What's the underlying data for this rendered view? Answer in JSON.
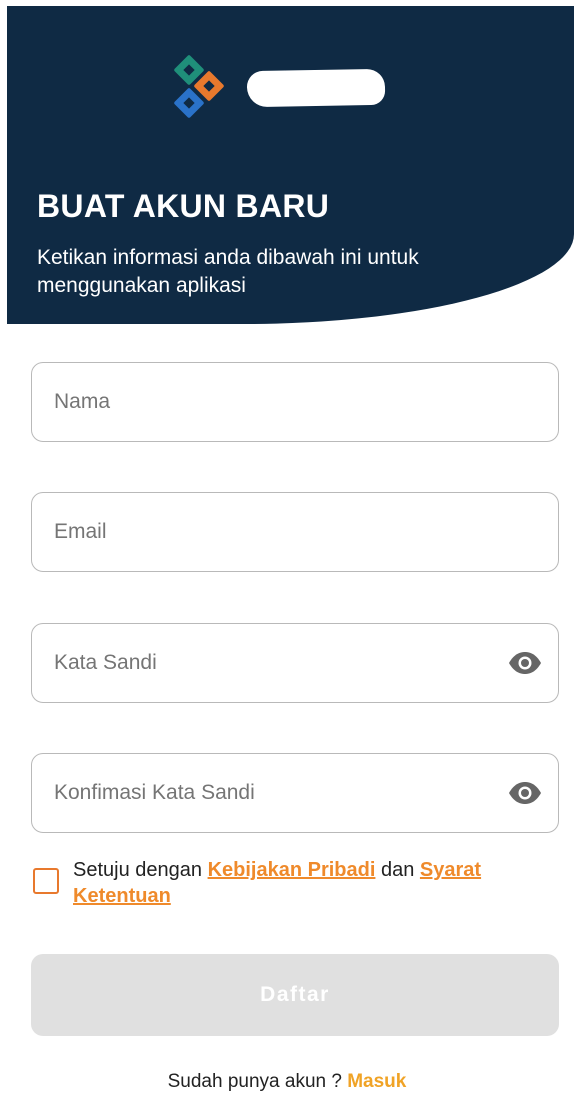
{
  "colors": {
    "header_bg": "#0f2a44",
    "accent_orange": "#ef8a2b",
    "login_link": "#f0a326",
    "logo_teal": "#1f8f7a",
    "logo_orange": "#e8792d",
    "logo_blue": "#2a72c9",
    "button_disabled": "#e0e0e0"
  },
  "header": {
    "logo_icon": "app-logo-icon",
    "title": "BUAT AKUN BARU",
    "subtitle": "Ketikan informasi anda dibawah ini untuk menggunakan aplikasi"
  },
  "form": {
    "name_placeholder": "Nama",
    "email_placeholder": "Email",
    "password_placeholder": "Kata Sandi",
    "confirm_password_placeholder": "Konfimasi Kata Sandi",
    "eye_icon": "eye-icon"
  },
  "terms": {
    "checked": false,
    "prefix": "Setuju dengan",
    "privacy_link": "Kebijakan Pribadi",
    "conjunction": "dan",
    "terms_link": "Syarat Ketentuan"
  },
  "submit": {
    "label": "Daftar"
  },
  "footer": {
    "question": "Sudah punya akun ?",
    "login_link": "Masuk"
  }
}
